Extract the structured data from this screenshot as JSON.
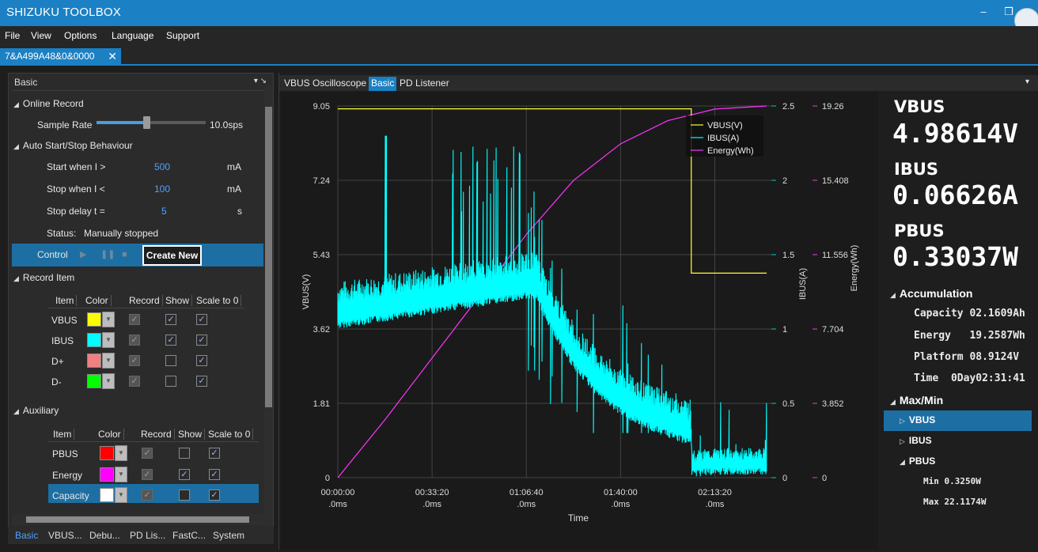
{
  "app": {
    "title": "SHIZUKU TOOLBOX"
  },
  "window_buttons": {
    "minimize": "–",
    "restore": "❒"
  },
  "menu": [
    "File",
    "View",
    "Options",
    "Language",
    "Support"
  ],
  "doc_tab": {
    "label": "7&A499A48&0&0000",
    "close": "✕"
  },
  "left_panel": {
    "header": "Basic",
    "header_icons": "▾ ↘",
    "online_record": "Online Record",
    "sample_rate_label": "Sample Rate",
    "sample_rate_value": "10.0sps",
    "auto_section": "Auto Start/Stop Behaviour",
    "start_when_label": "Start when I >",
    "start_when_value": "500",
    "start_when_unit": "mA",
    "stop_when_label": "Stop when I <",
    "stop_when_value": "100",
    "stop_when_unit": "mA",
    "stop_delay_label": "Stop delay  t =",
    "stop_delay_value": "5",
    "stop_delay_unit": "s",
    "status_label": "Status:",
    "status_value": "Manually stopped",
    "control_label": "Control",
    "create_new": "Create New",
    "record_item": "Record Item",
    "record_headers": [
      "Item",
      "Color",
      "Record",
      "Show",
      "Scale to 0"
    ],
    "record_rows": [
      {
        "item": "VBUS",
        "color": "#ffff00",
        "record": true,
        "show": true,
        "scale": true
      },
      {
        "item": "IBUS",
        "color": "#00ffff",
        "record": true,
        "show": true,
        "scale": true
      },
      {
        "item": "D+",
        "color": "#f08080",
        "record": true,
        "show": false,
        "scale": true
      },
      {
        "item": "D-",
        "color": "#00ff00",
        "record": true,
        "show": false,
        "scale": true
      }
    ],
    "auxiliary": "Auxiliary",
    "aux_headers": [
      "Item",
      "Color",
      "Record",
      "Show",
      "Scale to 0"
    ],
    "aux_rows": [
      {
        "item": "PBUS",
        "color": "#ff0000",
        "record": true,
        "show": false,
        "scale": true
      },
      {
        "item": "Energy",
        "color": "#ff00ff",
        "record": true,
        "show": true,
        "scale": true
      },
      {
        "item": "Capacity",
        "color": "#ffffff",
        "record": true,
        "show": false,
        "scale": true
      }
    ]
  },
  "bottom_tabs": [
    "Basic",
    "VBUS...",
    "Debu...",
    "PD Lis...",
    "FastC...",
    "System"
  ],
  "right_tabs": [
    "VBUS Oscilloscope",
    "Basic",
    "PD Listener"
  ],
  "readouts": {
    "vbus_label": "VBUS",
    "vbus_value": "4.98614V",
    "ibus_label": "IBUS",
    "ibus_value": "0.06626A",
    "pbus_label": "PBUS",
    "pbus_value": "0.33037W",
    "accumulation": "Accumulation",
    "capacity": "Capacity 02.1609Ah",
    "energy": "Energy   19.2587Wh",
    "platform": "Platform 08.9124V",
    "time": "Time  0Day02:31:41",
    "maxmin": "Max/Min",
    "mm_vbus": "VBUS",
    "mm_ibus": "IBUS",
    "mm_pbus": "PBUS",
    "pbus_min": "Min 0.3250W",
    "pbus_max": "Max 22.1174W"
  },
  "chart_data": {
    "type": "line",
    "xlabel": "Time",
    "ylabel_left": "VBUS(V)",
    "ylabel_right1": "IBUS(A)",
    "ylabel_right2": "Energy(Wh)",
    "x_ticks": [
      "00:00:00\n.0ms",
      "00:33:20\n.0ms",
      "01:06:40\n.0ms",
      "01:40:00\n.0ms",
      "02:13:20\n.0ms"
    ],
    "x_tick_seconds": [
      0,
      2000,
      4000,
      6000,
      8000
    ],
    "xlim_seconds": [
      0,
      9200
    ],
    "vbus_ticks": [
      "9.05",
      "7.24",
      "5.43",
      "3.62",
      "1.81",
      "0"
    ],
    "ibus_ticks": [
      "2.5",
      "2",
      "1.5",
      "1",
      "0.5",
      "0"
    ],
    "energy_ticks": [
      "19.26",
      "15.408",
      "11.556",
      "7.704",
      "3.852",
      "0"
    ],
    "vbus_ylim": [
      0,
      9.05
    ],
    "ibus_ylim": [
      0,
      2.5
    ],
    "energy_ylim": [
      0,
      19.26
    ],
    "legend": [
      "VBUS(V)",
      "IBUS(A)",
      "Energy(Wh)"
    ],
    "legend_position": "top-right",
    "grid": true,
    "colors": {
      "vbus": "#ffff33",
      "ibus": "#00ffff",
      "energy": "#ff33ff"
    },
    "series": [
      {
        "name": "VBUS(V)",
        "x": [
          0,
          7500,
          7500,
          9100
        ],
        "values": [
          8.98,
          8.98,
          4.98,
          4.98
        ]
      },
      {
        "name": "IBUS(A)",
        "x": [
          0,
          1000,
          2000,
          3000,
          4000,
          4200,
          4500,
          5000,
          5500,
          6000,
          6500,
          7000,
          7500,
          7500,
          8000,
          8500,
          9100
        ],
        "values": [
          1.05,
          1.1,
          1.15,
          1.2,
          1.25,
          1.25,
          1.05,
          0.78,
          0.6,
          0.47,
          0.38,
          0.32,
          0.26,
          0.05,
          0.07,
          0.07,
          0.07
        ]
      },
      {
        "name": "Energy(Wh)",
        "x": [
          0,
          1000,
          2000,
          3000,
          4000,
          5000,
          6000,
          7000,
          8000,
          9100
        ],
        "values": [
          0,
          3.0,
          6.2,
          9.4,
          12.6,
          15.4,
          17.3,
          18.5,
          19.1,
          19.26
        ]
      }
    ]
  }
}
